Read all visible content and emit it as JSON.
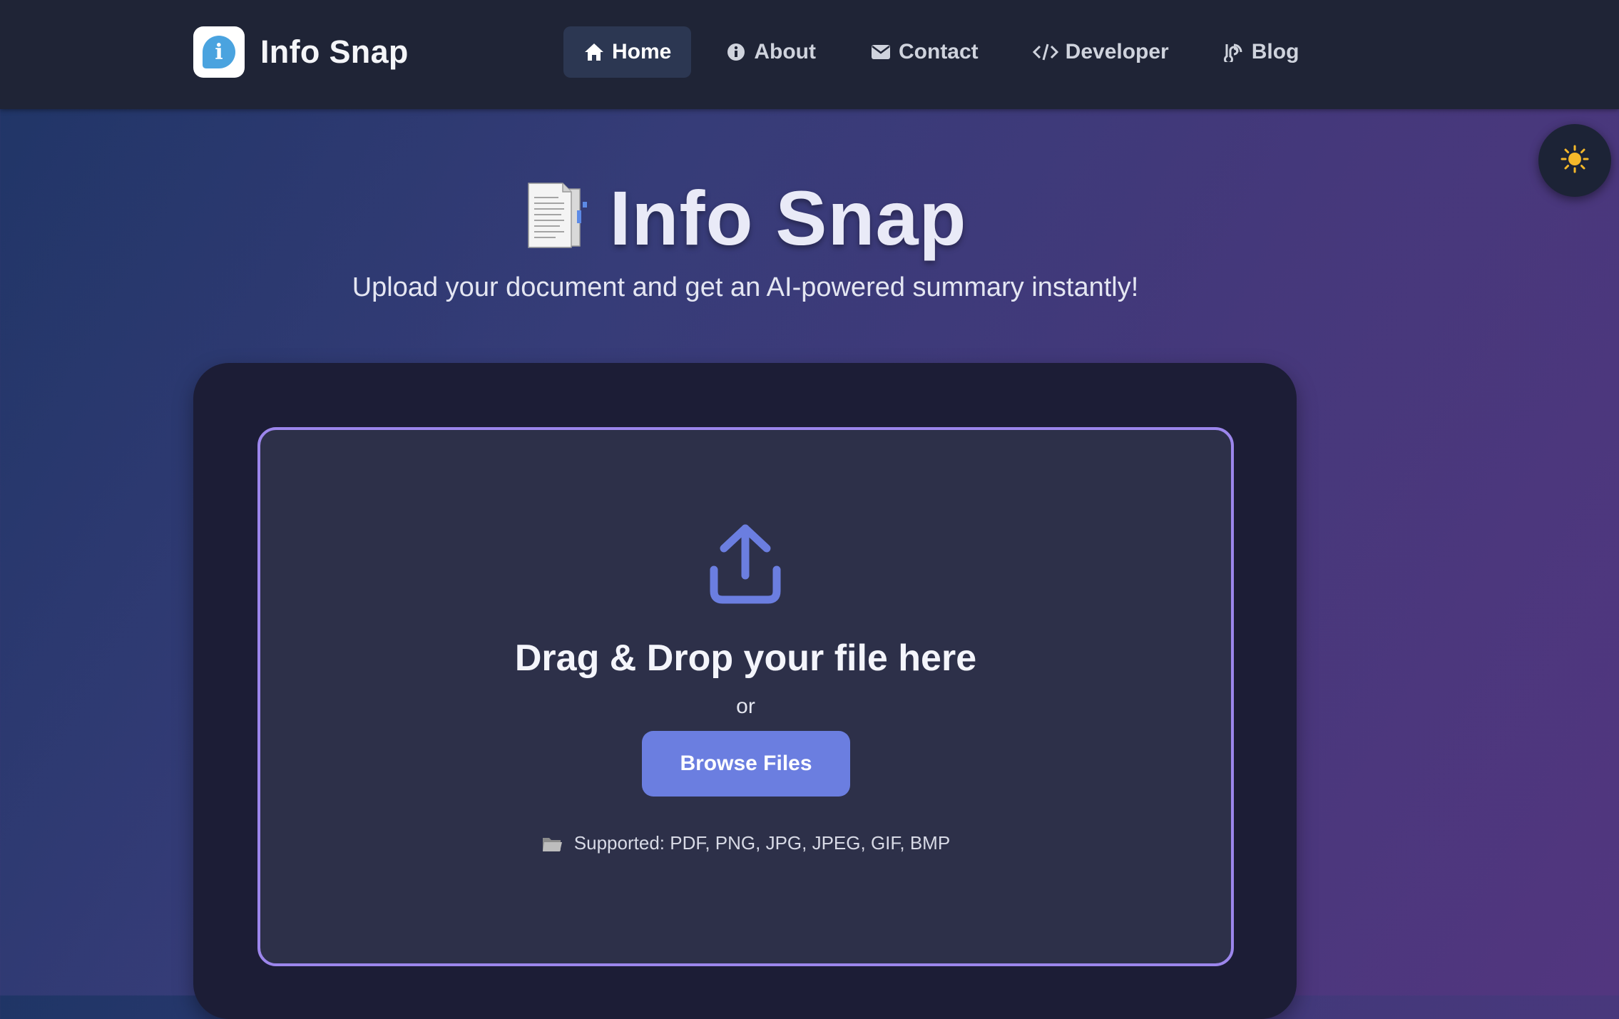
{
  "navbar": {
    "brand_name": "Info Snap",
    "brand_logo_glyph": "i",
    "items": [
      {
        "label": "Home",
        "icon": "home-icon",
        "active": true
      },
      {
        "label": "About",
        "icon": "info-circle-icon",
        "active": false
      },
      {
        "label": "Contact",
        "icon": "envelope-icon",
        "active": false
      },
      {
        "label": "Developer",
        "icon": "code-icon",
        "active": false
      },
      {
        "label": "Blog",
        "icon": "blog-icon",
        "active": false
      }
    ]
  },
  "theme_toggle": {
    "icon": "sun-icon"
  },
  "hero": {
    "title": "Info Snap",
    "title_icon": "document-icon",
    "subtitle": "Upload your document and get an AI-powered summary instantly!"
  },
  "upload": {
    "icon": "upload-icon",
    "title": "Drag & Drop your file here",
    "or_text": "or",
    "button_label": "Browse Files",
    "supported_icon": "folder-icon",
    "supported_text": "Supported: PDF, PNG, JPG, JPEG, GIF, BMP"
  },
  "colors": {
    "navbar_bg": "#1f2436",
    "accent": "#6b7ee0",
    "dropzone_border": "#9c86ec",
    "card_bg": "#1c1d36",
    "brand_logo_accent": "#4aa3df"
  }
}
